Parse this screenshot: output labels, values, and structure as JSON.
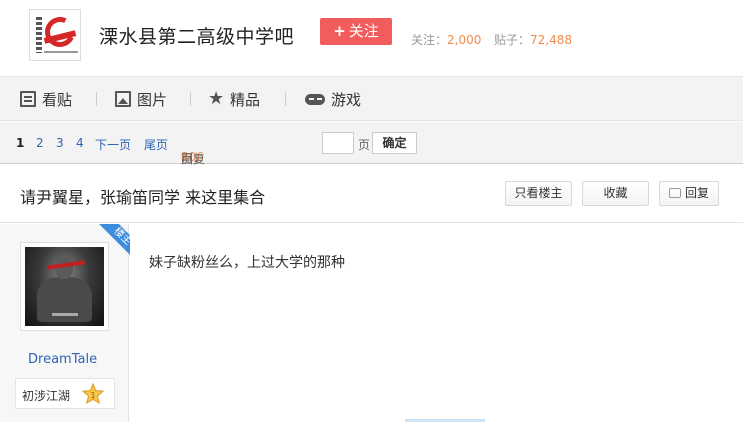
{
  "header": {
    "forum_name": "溧水县第二高级中学吧",
    "follow_label": "关注",
    "follow_count_label": "关注：",
    "follow_count": "2,000",
    "post_count_label": "贴子：",
    "post_count": "72,488",
    "colors": {
      "follow_button": "#f25c5c",
      "stat_number": "#f18c4b"
    }
  },
  "nav": {
    "items": [
      {
        "label": "看贴",
        "icon": "document-icon"
      },
      {
        "label": "图片",
        "icon": "image-icon"
      },
      {
        "label": "精品",
        "icon": "star-icon"
      },
      {
        "label": "游戏",
        "icon": "gamepad-icon"
      }
    ]
  },
  "pager": {
    "current": "1",
    "pages": [
      "2",
      "3",
      "4"
    ],
    "next": "下一页",
    "last": "尾页",
    "reply_count": "106",
    "reply_text": "回复贴，共",
    "page_total": "4",
    "page_suffix": "页，跳到",
    "page_unit": "页",
    "confirm": "确定"
  },
  "thread": {
    "title": "请尹翼星，张瑜笛同学 来这里集合",
    "only_op_label": "只看楼主",
    "collect_label": "收藏",
    "reply_label": "回复"
  },
  "post": {
    "ribbon": "楼主",
    "username": "DreamTale",
    "level_name": "初涉江湖",
    "level": "1",
    "content": "妹子缺粉丝么，上过大学的那种"
  }
}
